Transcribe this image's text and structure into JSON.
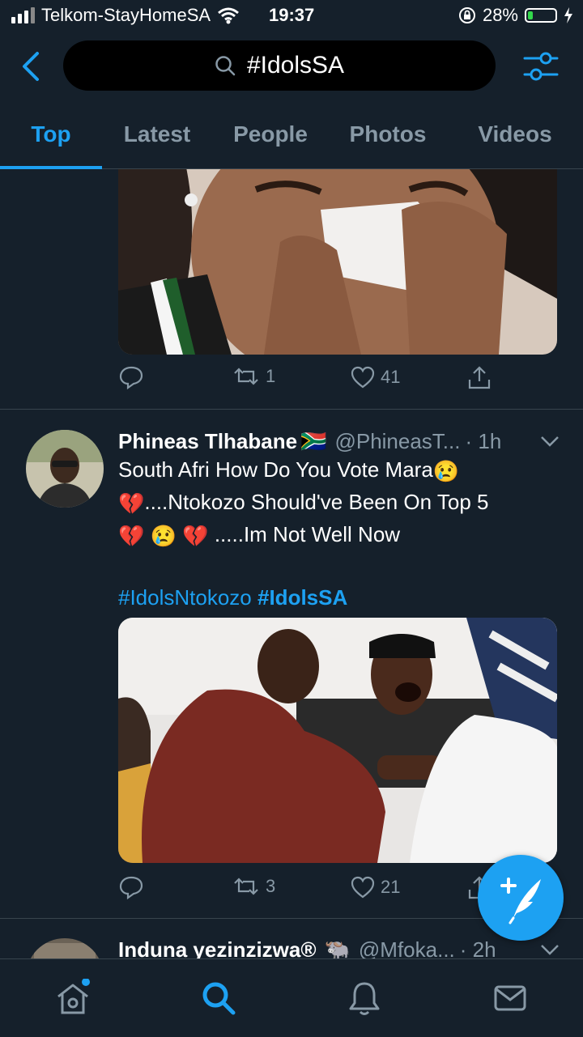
{
  "status_bar": {
    "carrier": "Telkom-StayHomeSA",
    "time": "19:37",
    "battery": "28%",
    "battery_level": 0.28
  },
  "header": {
    "search_query": "#IdolsSA"
  },
  "tabs": [
    {
      "label": "Top",
      "active": true
    },
    {
      "label": "Latest"
    },
    {
      "label": "People"
    },
    {
      "label": "Photos"
    },
    {
      "label": "Videos"
    }
  ],
  "tweets": [
    {
      "retweets": "1",
      "likes": "41"
    },
    {
      "name": "Phineas Tlhabane",
      "name_emoji": "🇿🇦",
      "handle": "@PhineasT...",
      "time": "· 1h",
      "line1": "South Afri How Do You Vote Mara",
      "line2": "....Ntokozo Should've Been On Top 5",
      "line3": ".....Im Not Well Now",
      "hashtag1": "#IdolsNtokozo",
      "hashtag2": "#IdolsSA",
      "retweets": "3",
      "likes": "21"
    },
    {
      "name": "Induna yezinzizwa®",
      "name_emoji": "🐃",
      "handle": "@Mfoka...",
      "time": "· 2h"
    }
  ],
  "colors": {
    "background": "#15202b",
    "accent": "#1da1f2",
    "muted": "#8899a6",
    "divider": "#38444d"
  },
  "icons": [
    "back-arrow-icon",
    "search-icon",
    "filter-icon",
    "reply-icon",
    "retweet-icon",
    "like-icon",
    "share-icon",
    "compose-icon",
    "home-icon",
    "explore-search-icon",
    "notifications-icon",
    "messages-icon"
  ]
}
